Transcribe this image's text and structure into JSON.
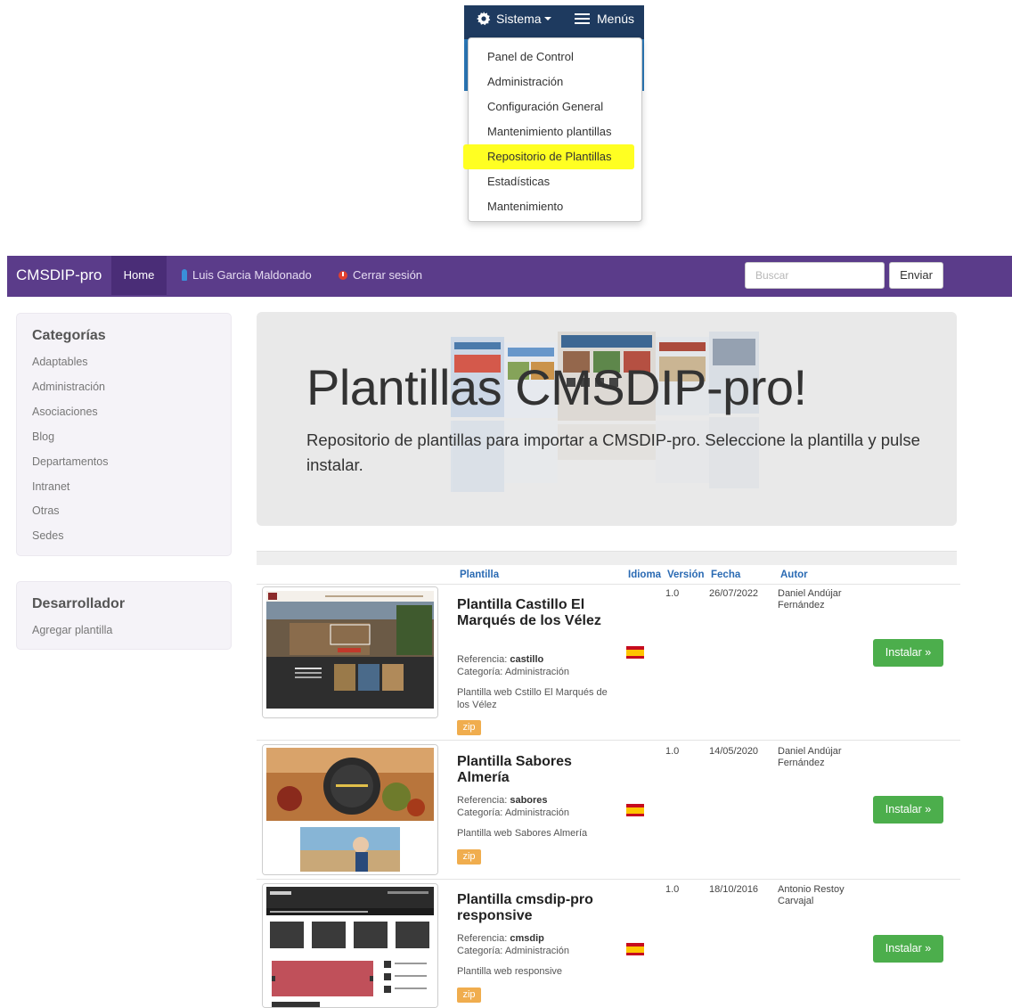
{
  "menu": {
    "sistema_label": "Sistema",
    "menus_label": "Menús",
    "items": [
      "Panel de Control",
      "Administración",
      "Configuración General",
      "Mantenimiento plantillas",
      "Repositorio de Plantillas",
      "Estadísticas",
      "Mantenimiento"
    ],
    "highlighted_index": 4,
    "highlight_color": "#ffff22"
  },
  "navbar": {
    "brand": "CMSDIP-pro",
    "home": "Home",
    "user": "Luis Garcia Maldonado",
    "logout": "Cerrar sesión",
    "search_placeholder": "Buscar",
    "send": "Enviar",
    "color": "#5b3c8a"
  },
  "sidebar": {
    "categories_title": "Categorías",
    "categories": [
      "Adaptables",
      "Administración",
      "Asociaciones",
      "Blog",
      "Departamentos",
      "Intranet",
      "Otras",
      "Sedes"
    ],
    "dev_title": "Desarrollador",
    "dev_links": [
      "Agregar plantilla"
    ]
  },
  "jumbotron": {
    "title": "Plantillas CMSDIP-pro!",
    "subtitle": "Repositorio de plantillas para importar a CMSDIP-pro. Seleccione la plantilla y pulse instalar."
  },
  "table": {
    "headers": {
      "plantilla": "Plantilla",
      "idioma": "Idioma",
      "version": "Versión",
      "fecha": "Fecha",
      "autor": "Autor"
    },
    "rows": [
      {
        "name": "Plantilla Castillo El Marqués de los Vélez",
        "ref_label": "Referencia:",
        "ref": "castillo",
        "category": "Categoría: Administración",
        "desc": "Plantilla web Cstillo El Marqués de los Vélez",
        "zip": "zip",
        "version": "1.0",
        "date": "26/07/2022",
        "author": "Daniel Andújar Fernández",
        "install": "Instalar »",
        "language_icon": "spain-flag"
      },
      {
        "name": "Plantilla Sabores Almería",
        "ref_label": "Referencia:",
        "ref": "sabores",
        "category": "Categoría: Administración",
        "desc": "Plantilla web Sabores Almería",
        "zip": "zip",
        "version": "1.0",
        "date": "14/05/2020",
        "author": "Daniel Andújar Fernández",
        "install": "Instalar »",
        "language_icon": "spain-flag"
      },
      {
        "name": "Plantilla cmsdip-pro responsive",
        "ref_label": "Referencia:",
        "ref": "cmsdip",
        "category": "Categoría: Administración",
        "desc": "Plantilla web responsive",
        "zip": "zip",
        "version": "1.0",
        "date": "18/10/2016",
        "author": "Antonio Restoy Carvajal",
        "install": "Instalar »",
        "language_icon": "spain-flag"
      }
    ]
  },
  "colors": {
    "install_button": "#4cae4c",
    "zip_badge": "#f0ad4e",
    "header_link": "#2a6ab3"
  }
}
